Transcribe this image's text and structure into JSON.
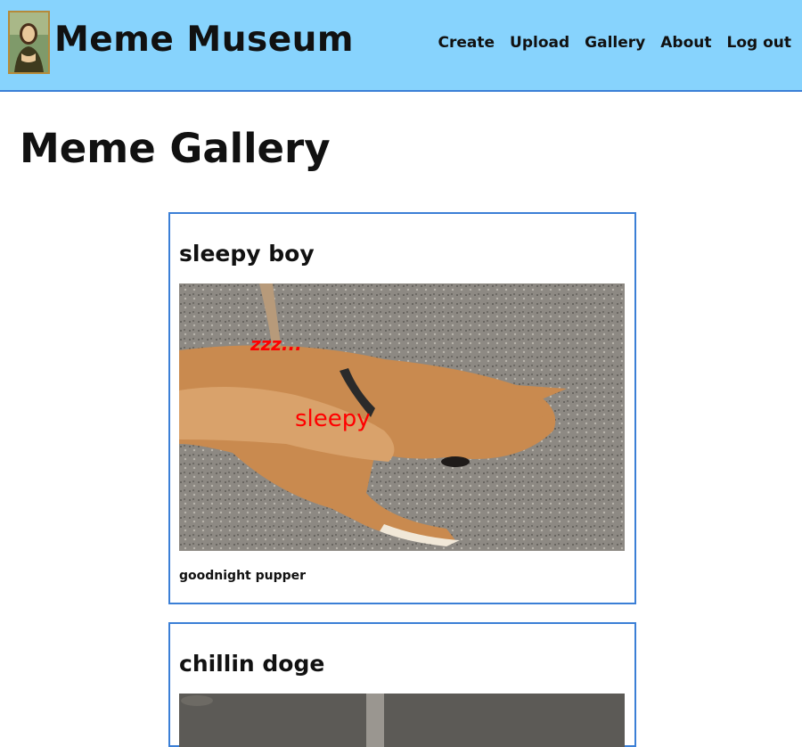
{
  "header": {
    "site_title": "Meme Museum",
    "nav": [
      "Create",
      "Upload",
      "Gallery",
      "About",
      "Log out"
    ],
    "colors": {
      "background": "#87d3fd",
      "border": "#3b7fd6"
    }
  },
  "page_title": "Meme Gallery",
  "memes": [
    {
      "title": "sleepy boy",
      "overlay_texts": [
        "zzz...",
        "sleepy"
      ],
      "caption": "goodnight pupper",
      "overlay_color": "#ff0000"
    },
    {
      "title": "chillin doge"
    }
  ]
}
